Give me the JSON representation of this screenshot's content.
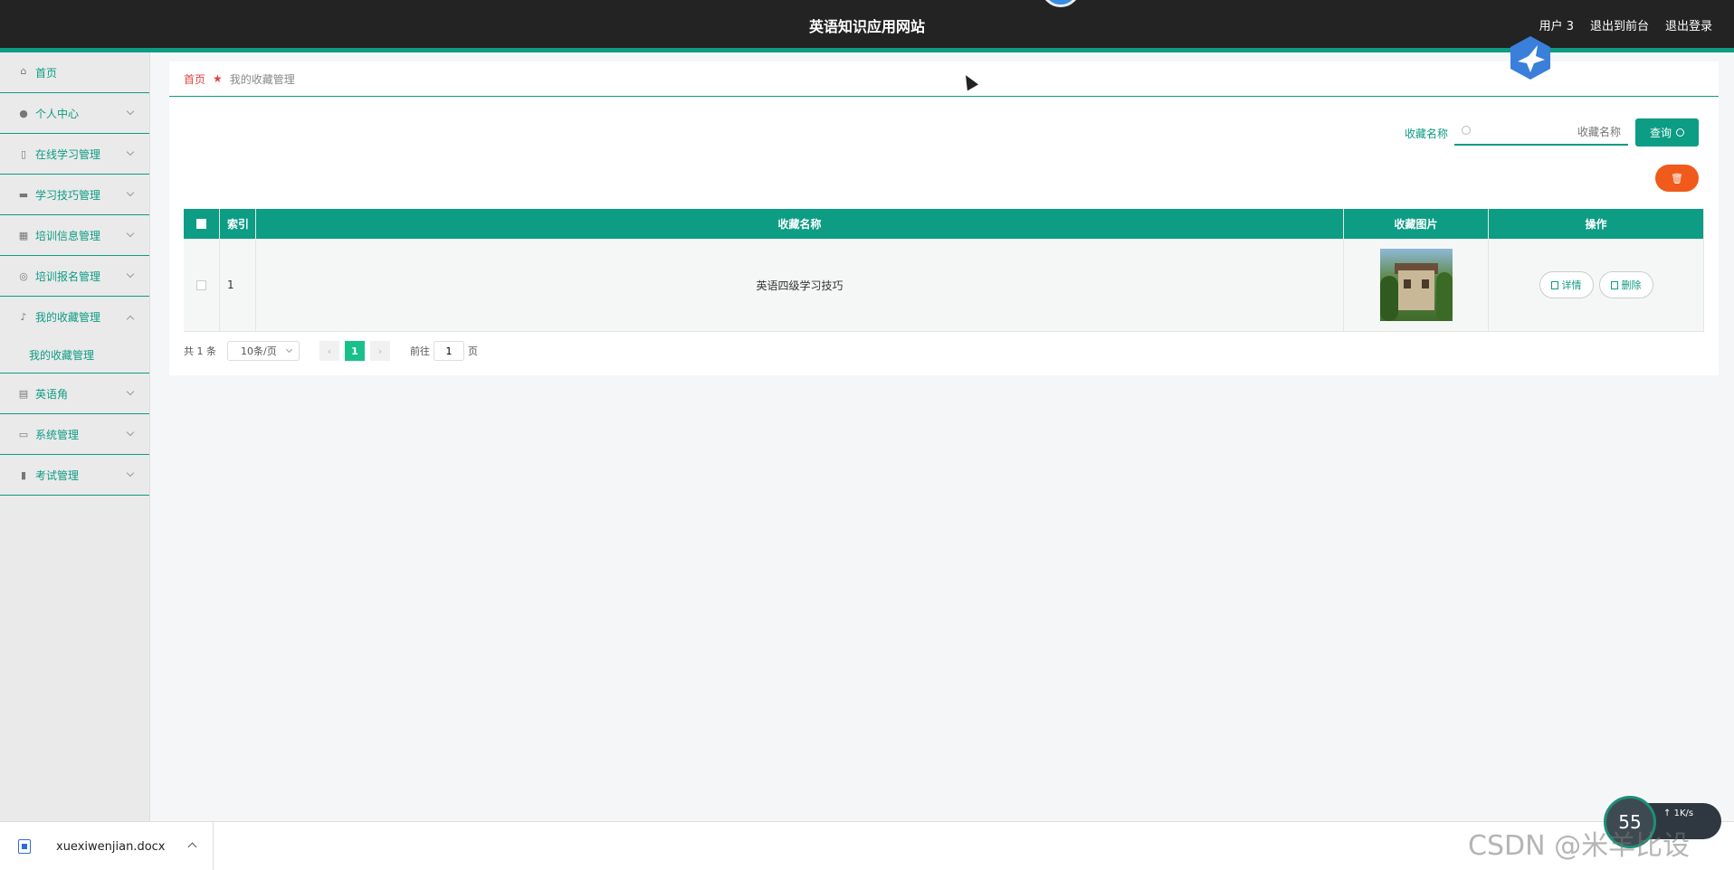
{
  "header": {
    "title": "英语知识应用网站",
    "links": [
      "用户 3",
      "退出到前台",
      "退出登录"
    ]
  },
  "sidebar": {
    "items": [
      {
        "label": "首页",
        "icon": "home-icon"
      },
      {
        "label": "个人中心",
        "icon": "user-icon"
      },
      {
        "label": "在线学习管理",
        "icon": "mobile-icon"
      },
      {
        "label": "学习技巧管理",
        "icon": "ticket-icon"
      },
      {
        "label": "培训信息管理",
        "icon": "grid-icon"
      },
      {
        "label": "培训报名管理",
        "icon": "target-icon"
      },
      {
        "label": "我的收藏管理",
        "icon": "microphone-icon"
      },
      {
        "label": "英语角",
        "icon": "clipboard-icon"
      },
      {
        "label": "系统管理",
        "icon": "chat-icon"
      },
      {
        "label": "考试管理",
        "icon": "bar-chart-icon"
      }
    ],
    "subitems": {
      "favorites": "我的收藏管理"
    }
  },
  "breadcrumb": {
    "home": "首页",
    "current": "我的收藏管理"
  },
  "search": {
    "label": "收藏名称",
    "placeholder": "收藏名称",
    "button": "查询"
  },
  "table": {
    "headers": {
      "index": "索引",
      "name": "收藏名称",
      "image": "收藏图片",
      "ops": "操作"
    },
    "rows": [
      {
        "index": "1",
        "name": "英语四级学习技巧",
        "detail": "详情",
        "delete": "删除"
      }
    ]
  },
  "pagination": {
    "total": "共 1 条",
    "page_size": "10条/页",
    "current_page": "1",
    "goto_label": "前往",
    "goto_value": "1",
    "page_suffix": "页",
    "prev_icon": "‹",
    "next_icon": "›"
  },
  "download": {
    "filename": "xuexiwenjian.docx"
  },
  "overlay": {
    "net_percent": "55",
    "net_speed": "1",
    "net_unit": "K/s",
    "watermark": "CSDN @米羊比设"
  },
  "colors": {
    "primary": "#0d9c84",
    "danger": "#f05a1a",
    "header_bg": "#232323",
    "active_page": "#19c08a"
  }
}
